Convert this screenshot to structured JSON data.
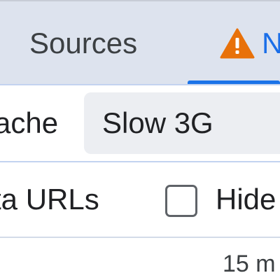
{
  "tabs": {
    "sources": "Sources",
    "network": "N",
    "network_warning_icon": "warning-triangle-icon"
  },
  "toolbar": {
    "disable_cache_label": "ache",
    "throttling_value": "Slow 3G",
    "hide_data_urls_label": "ta URLs",
    "hide_extension_label": "Hide",
    "hide_checkbox_checked": false
  },
  "overview": {
    "time_label": "15 m"
  },
  "colors": {
    "accent": "#1a73e8",
    "warning": "#e8710a",
    "tabstrip_bg": "#dde3ee"
  }
}
